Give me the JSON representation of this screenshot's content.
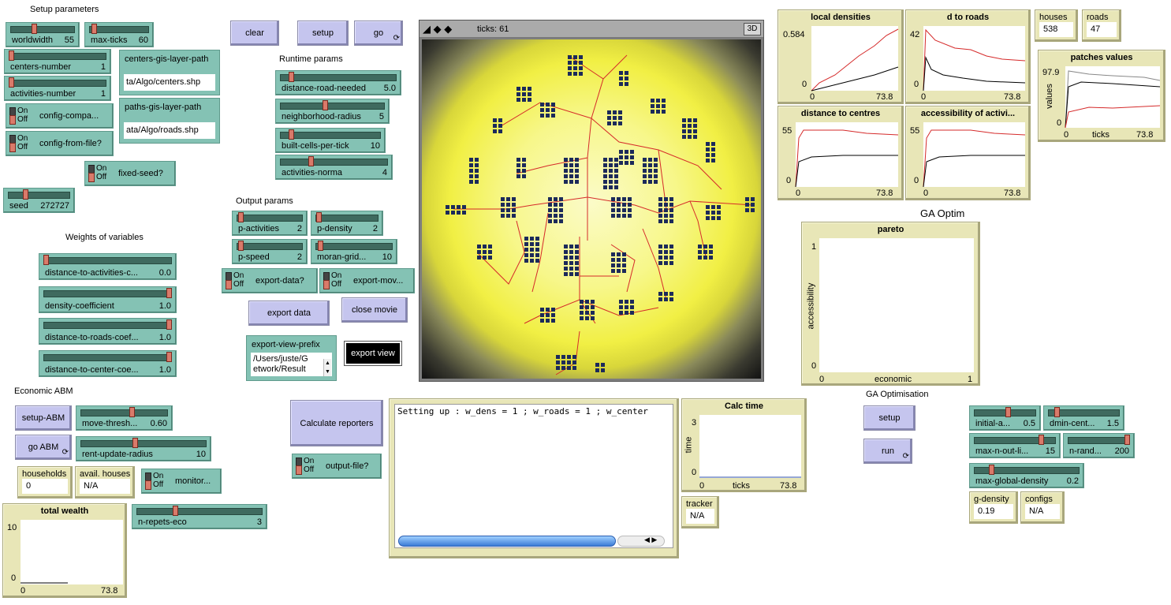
{
  "labels": {
    "setup_parameters": "Setup parameters",
    "runtime_params": "Runtime params",
    "output_params": "Output params",
    "weights_of_variables": "Weights of variables",
    "economic_abm": "Economic ABM",
    "ga_optim": "GA Optim",
    "ga_optimisation": "GA Optimisation"
  },
  "buttons": {
    "clear": "clear",
    "setup": "setup",
    "go": "go",
    "export_data": "export data",
    "close_movie": "close movie",
    "export_view": "export view",
    "calculate_reporters": "Calculate reporters",
    "setup_abm": "setup-ABM",
    "go_abm": "go ABM",
    "ga_setup": "setup",
    "ga_run": "run",
    "forever_glyph": "⟳"
  },
  "sliders": [
    {
      "key": "worldwidth",
      "label": "worldwidth",
      "value": "55",
      "frac": 0.36
    },
    {
      "key": "max_ticks",
      "label": "max-ticks",
      "value": "60",
      "frac": 0.04
    },
    {
      "key": "centers_number",
      "label": "centers-number",
      "value": "1",
      "frac": 0.0
    },
    {
      "key": "activities_number",
      "label": "activities-number",
      "value": "1",
      "frac": 0.0
    },
    {
      "key": "seed",
      "label": "seed",
      "value": "272727",
      "frac": 0.27
    },
    {
      "key": "distance_road_needed",
      "label": "distance-road-needed",
      "value": "5.0",
      "frac": 0.08
    },
    {
      "key": "neighborhood_radius",
      "label": "neighborhood-radius",
      "value": "5",
      "frac": 0.43
    },
    {
      "key": "built_cells_per_tick",
      "label": "built-cells-per-tick",
      "value": "10",
      "frac": 0.09
    },
    {
      "key": "activities_norma",
      "label": "activities-norma",
      "value": "4",
      "frac": 0.28
    },
    {
      "key": "p_activities",
      "label": "p-activities",
      "value": "2",
      "frac": 0.02
    },
    {
      "key": "p_density",
      "label": "p-density",
      "value": "2",
      "frac": 0.02
    },
    {
      "key": "p_speed",
      "label": "p-speed",
      "value": "2",
      "frac": 0.02
    },
    {
      "key": "moran_grid",
      "label": "moran-grid...",
      "value": "10",
      "frac": 0.03
    },
    {
      "key": "distance_to_activities_coef",
      "label": "distance-to-activities-c...",
      "value": "0.0",
      "frac": 0.0
    },
    {
      "key": "density_coefficient",
      "label": "density-coefficient",
      "value": "1.0",
      "frac": 1.0
    },
    {
      "key": "distance_to_roads_coef",
      "label": "distance-to-roads-coef...",
      "value": "1.0",
      "frac": 1.0
    },
    {
      "key": "distance_to_center_coef",
      "label": "distance-to-center-coe...",
      "value": "1.0",
      "frac": 1.0
    },
    {
      "key": "move_threshold",
      "label": "move-thresh...",
      "value": "0.60",
      "frac": 0.6
    },
    {
      "key": "rent_update_radius",
      "label": "rent-update-radius",
      "value": "10",
      "frac": 0.43
    },
    {
      "key": "n_repets_eco",
      "label": "n-repets-eco",
      "value": "3",
      "frac": 0.3
    },
    {
      "key": "initial_a",
      "label": "initial-a...",
      "value": "0.5",
      "frac": 0.55
    },
    {
      "key": "dmin_cent",
      "label": "dmin-cent...",
      "value": "1.5",
      "frac": 0.1
    },
    {
      "key": "max_n_out_li",
      "label": "max-n-out-li...",
      "value": "15",
      "frac": 0.85
    },
    {
      "key": "n_rand",
      "label": "n-rand...",
      "value": "200",
      "frac": 1.0
    },
    {
      "key": "max_global_density",
      "label": "max-global-density",
      "value": "0.2",
      "frac": 0.15
    }
  ],
  "switches": {
    "on": "On",
    "off": "Off",
    "config_compa": "config-compa...",
    "config_from_file": "config-from-file?",
    "fixed_seed": "fixed-seed?",
    "export_data_q": "export-data?",
    "export_mov": "export-mov...",
    "output_file": "output-file?",
    "monitor": "monitor..."
  },
  "inputs": {
    "centers_gis_layer_path": {
      "label": "centers-gis-layer-path",
      "value": "ta/Algo/centers.shp"
    },
    "paths_gis_layer_path": {
      "label": "paths-gis-layer-path",
      "value": "ata/Algo/roads.shp"
    },
    "export_view_prefix": {
      "label": "export-view-prefix",
      "value": "/Users/juste/G",
      "value2": "etwork/Result"
    }
  },
  "monitors": {
    "houses": {
      "label": "houses",
      "value": "538"
    },
    "roads": {
      "label": "roads",
      "value": "47"
    },
    "households": {
      "label": "households",
      "value": "0"
    },
    "avail_houses": {
      "label": "avail. houses",
      "value": "N/A"
    },
    "tracker": {
      "label": "tracker",
      "value": "N/A"
    },
    "g_density": {
      "label": "g-density",
      "value": "0.19"
    },
    "configs": {
      "label": "configs",
      "value": "N/A"
    }
  },
  "view": {
    "ticks_label": "ticks: 61",
    "btn_3d": "3D"
  },
  "output": {
    "text": "Setting up : w_dens = 1 ; w_roads = 1 ; w_center"
  },
  "plots": {
    "local_densities": {
      "title": "local densities",
      "ymax": "0.584",
      "ymin": "0",
      "xmin": "0",
      "xmax": "73.8"
    },
    "d_to_roads": {
      "title": "d to roads",
      "ymax": "42",
      "ymin": "0",
      "xmin": "0",
      "xmax": "73.8"
    },
    "patches_values": {
      "title": "patches values",
      "ymax": "97.9",
      "ymin": "0",
      "xmin": "0",
      "xmax": "73.8",
      "xlabel": "ticks",
      "ylabel": "values"
    },
    "distance_to_centres": {
      "title": "distance to centres",
      "ymax": "55",
      "ymin": "0",
      "xmin": "0",
      "xmax": "73.8"
    },
    "accessibility_of_activities": {
      "title": "accessibility of activi...",
      "ymax": "55",
      "ymin": "0",
      "xmin": "0",
      "xmax": "73.8"
    },
    "pareto": {
      "title": "pareto",
      "ymax": "1",
      "ymin": "0",
      "xmin": "0",
      "xmax": "1",
      "xlabel": "economic",
      "ylabel": "accessibility"
    },
    "calc_time": {
      "title": "Calc time",
      "ymax": "3",
      "ymin": "0",
      "xmin": "0",
      "xmax": "73.8",
      "xlabel": "ticks",
      "ylabel": "time"
    },
    "total_wealth": {
      "title": "total wealth",
      "ymax": "10",
      "ymin": "0",
      "xmin": "0",
      "xmax": "73.8"
    }
  },
  "colors": {
    "button": "#c5c5ee",
    "slider": "#84c2b4",
    "monitor": "#e8e6b7",
    "road": "#d52a2a"
  }
}
